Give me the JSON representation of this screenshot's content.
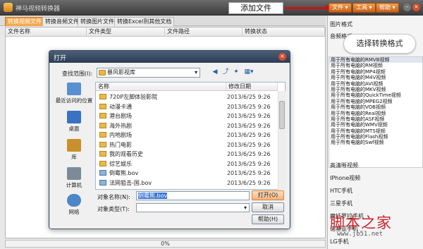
{
  "app": {
    "title": "神马视频转换器"
  },
  "callouts": {
    "add_file": "添加文件",
    "select_format": "选择转换格式"
  },
  "menu": {
    "file": "文件",
    "tools": "工具",
    "help": "帮助"
  },
  "tabs": [
    "转换视频文件",
    "转换音频文件",
    "转换图片文件",
    "转换Excel到其他文档"
  ],
  "columns": [
    "文件名称",
    "文件类型",
    "文件路径",
    "转换状态"
  ],
  "progress": {
    "text": "0%",
    "value": 0
  },
  "right": {
    "image_format": "图片格式",
    "audio_format": "音频格式",
    "formats": [
      "用于所有电脑的RMVB视频",
      "用于所有电脑的RM视频",
      "用于所有电脑的MP4视频",
      "用于所有电脑的M4V视频",
      "用于所有电脑的AVI视频",
      "用于所有电脑的MKV视频",
      "用于所有电脑的QuickTime视频",
      "用于所有电脑的MPEG2视频",
      "用于所有电脑的VOB视频",
      "用于所有电脑的Real视频",
      "用于所有电脑的ASF视频",
      "用于所有电脑的WMV视频",
      "用于所有电脑的MTS视频",
      "用于所有电脑的Flash视频",
      "用于所有电脑的Swf视频"
    ],
    "devices": [
      "高清晰视频",
      "IPhone视频",
      "HTC手机",
      "三星手机",
      "摩托罗拉手机",
      "诺基亚手机",
      "LG手机"
    ]
  },
  "watermark": {
    "text": "脚本之家",
    "url": "www.jb51.net"
  },
  "dialog": {
    "title": "打开",
    "lookin_label": "查找范围(I):",
    "lookin_value": "暴风影视库",
    "places": [
      "最近访问的位置",
      "桌面",
      "库",
      "计算机",
      "网络"
    ],
    "columns": [
      "名称",
      "修改日期"
    ],
    "files": [
      {
        "name": "720P左脚体验影院",
        "date": "2013/6/25 9:26",
        "kind": "folder"
      },
      {
        "name": "动漫卡通",
        "date": "2013/6/25 9:26",
        "kind": "folder"
      },
      {
        "name": "港台剧场",
        "date": "2013/6/25 9:26",
        "kind": "folder"
      },
      {
        "name": "海外热剧",
        "date": "2013/6/25 9:26",
        "kind": "folder"
      },
      {
        "name": "内地剧场",
        "date": "2013/6/25 9:26",
        "kind": "folder"
      },
      {
        "name": "热门电影",
        "date": "2013/6/25 9:26",
        "kind": "folder"
      },
      {
        "name": "我的观看历史",
        "date": "2013/6/25 9:26",
        "kind": "folder"
      },
      {
        "name": "综艺娱乐",
        "date": "2013/6/25 9:26",
        "kind": "folder"
      },
      {
        "name": "倒霉熊.bov",
        "date": "2013/6/25 9:26",
        "kind": "video"
      },
      {
        "name": "法网狙击-国.bov",
        "date": "2013/6/25 9:26",
        "kind": "video"
      }
    ],
    "filename_label": "对象名称(N):",
    "filename_value": "倒霉熊.bov",
    "filetype_label": "对象类型(T):",
    "open_btn": "打开(O)",
    "cancel_btn": "取消",
    "help_btn": "帮助(H)"
  },
  "colors": {
    "accent": "#f5a74e",
    "titlebar": "#3c3c3c",
    "arrow": "#c81414",
    "selection": "#3875d7"
  }
}
